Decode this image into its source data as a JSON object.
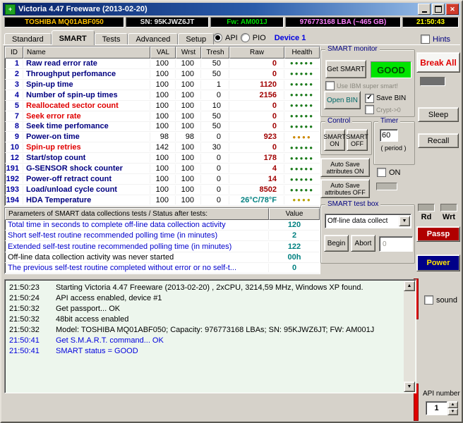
{
  "window": {
    "title": "Victoria 4.47 Freeware (2013-02-20)",
    "close": "✕"
  },
  "infobar": {
    "model": "TOSHIBA MQ01ABF050",
    "serial": "SN: 95KJWZ6JT",
    "firmware": "Fw: AM001J",
    "capacity": "976773168 LBA (~465 GB)",
    "clock": "21:50:43"
  },
  "tabs": [
    "Standard",
    "SMART",
    "Tests",
    "Advanced",
    "Setup"
  ],
  "mode": {
    "api": "API",
    "pio": "PIO",
    "device": "Device 1",
    "hints": "Hints"
  },
  "smart_table": {
    "headers": [
      "ID",
      "Name",
      "VAL",
      "Wrst",
      "Tresh",
      "Raw",
      "Health"
    ],
    "rows": [
      {
        "id": "1",
        "name": "Raw read error rate",
        "val": "100",
        "wrst": "100",
        "tresh": "50",
        "raw": "0",
        "health_dots": 5,
        "health_color": "#1a7a1a"
      },
      {
        "id": "2",
        "name": "Throughput perfomance",
        "val": "100",
        "wrst": "100",
        "tresh": "50",
        "raw": "0",
        "health_dots": 5,
        "health_color": "#1a7a1a"
      },
      {
        "id": "3",
        "name": "Spin-up time",
        "val": "100",
        "wrst": "100",
        "tresh": "1",
        "raw": "1120",
        "health_dots": 5,
        "health_color": "#1a7a1a"
      },
      {
        "id": "4",
        "name": "Number of spin-up times",
        "val": "100",
        "wrst": "100",
        "tresh": "0",
        "raw": "2156",
        "health_dots": 5,
        "health_color": "#1a7a1a"
      },
      {
        "id": "5",
        "name": "Reallocated sector count",
        "val": "100",
        "wrst": "100",
        "tresh": "10",
        "raw": "0",
        "name_color": "#e00000",
        "health_dots": 5,
        "health_color": "#1a7a1a"
      },
      {
        "id": "7",
        "name": "Seek error rate",
        "val": "100",
        "wrst": "100",
        "tresh": "50",
        "raw": "0",
        "name_color": "#e00000",
        "health_dots": 5,
        "health_color": "#1a7a1a"
      },
      {
        "id": "8",
        "name": "Seek time perfomance",
        "val": "100",
        "wrst": "100",
        "tresh": "50",
        "raw": "0",
        "health_dots": 5,
        "health_color": "#1a7a1a"
      },
      {
        "id": "9",
        "name": "Power-on time",
        "val": "98",
        "wrst": "98",
        "tresh": "0",
        "raw": "923",
        "health_dots": 4,
        "health_color": "#cc8800"
      },
      {
        "id": "10",
        "name": "Spin-up retries",
        "val": "142",
        "wrst": "100",
        "tresh": "30",
        "raw": "0",
        "name_color": "#e00000",
        "health_dots": 5,
        "health_color": "#1a7a1a"
      },
      {
        "id": "12",
        "name": "Start/stop count",
        "val": "100",
        "wrst": "100",
        "tresh": "0",
        "raw": "178",
        "health_dots": 5,
        "health_color": "#1a7a1a"
      },
      {
        "id": "191",
        "name": "G-SENSOR shock counter",
        "val": "100",
        "wrst": "100",
        "tresh": "0",
        "raw": "4",
        "health_dots": 5,
        "health_color": "#1a7a1a"
      },
      {
        "id": "192",
        "name": "Power-off retract count",
        "val": "100",
        "wrst": "100",
        "tresh": "0",
        "raw": "14",
        "health_dots": 5,
        "health_color": "#1a7a1a"
      },
      {
        "id": "193",
        "name": "Load/unload cycle count",
        "val": "100",
        "wrst": "100",
        "tresh": "0",
        "raw": "8502",
        "health_dots": 5,
        "health_color": "#1a7a1a"
      },
      {
        "id": "194",
        "name": "HDA Temperature",
        "val": "100",
        "wrst": "100",
        "tresh": "0",
        "raw": "26°C/78°F",
        "raw_color": "#008080",
        "health_dots": 4,
        "health_color": "#b8a000"
      }
    ]
  },
  "params_table": {
    "headers": [
      "Parameters of SMART data collections tests / Status after tests:",
      "Value"
    ],
    "rows": [
      {
        "text": "Total time in seconds to complete off-line data collection activity",
        "value": "120",
        "text_color": "#0000cc"
      },
      {
        "text": "Short self-test routine recommended polling time (in minutes)",
        "value": "2",
        "text_color": "#0000cc"
      },
      {
        "text": "Extended self-test routine recommended polling time (in minutes)",
        "value": "122",
        "text_color": "#0000cc"
      },
      {
        "text": "Off-line data collection activity was never started",
        "value": "00h",
        "text_color": "#000000"
      },
      {
        "text": "The previous self-test routine completed without error or no self-t...",
        "value": "0",
        "text_color": "#0000cc"
      }
    ]
  },
  "monitor": {
    "title": "SMART monitor",
    "get_smart": "Get SMART",
    "status": "GOOD",
    "ibm_check": "Use IBM super smart!",
    "open_bin": "Open BIN",
    "save_bin": "Save BIN",
    "crypt": "Crypt->0"
  },
  "control": {
    "title": "Control",
    "smart_on": "SMART ON",
    "smart_off": "SMART OFF"
  },
  "timer": {
    "title": "Timer",
    "value": "60",
    "period": "( period )",
    "on": "ON"
  },
  "autosave": {
    "on": "Auto Save attributes ON",
    "off": "Auto Save attributes OFF"
  },
  "testbox": {
    "title": "SMART test box",
    "selected": "Off-line data collect",
    "begin": "Begin",
    "abort": "Abort",
    "progress": "0"
  },
  "rightbar": {
    "break_all": "Break All",
    "sleep": "Sleep",
    "recall": "Recall",
    "rd": "Rd",
    "wrt": "Wrt",
    "passp": "Passp",
    "power": "Power",
    "sound": "sound",
    "api_number": "API number",
    "api_value": "1"
  },
  "log": [
    {
      "time": "21:50:23",
      "text": "Starting Victoria 4.47  Freeware  (2013-02-20) , 2xCPU, 3214,59 MHz, Windows XP found.",
      "color": "#000000"
    },
    {
      "time": "21:50:24",
      "text": "API access enabled, device #1",
      "color": "#000000"
    },
    {
      "time": "21:50:32",
      "text": "Get passport... OK",
      "color": "#000000"
    },
    {
      "time": "21:50:32",
      "text": "48bit access enabled",
      "color": "#000000"
    },
    {
      "time": "21:50:32",
      "text": "Model: TOSHIBA MQ01ABF050; Capacity: 976773168 LBAs; SN: 95KJWZ6JT; FW: AM001J",
      "color": "#000000"
    },
    {
      "time": "21:50:41",
      "text": "Get S.M.A.R.T. command... OK",
      "color": "#0000dd"
    },
    {
      "time": "21:50:41",
      "text": "SMART status = GOOD",
      "color": "#0000dd"
    }
  ],
  "colors": {
    "good_bg": "#00e400",
    "accent_red": "#e00000",
    "navy": "#000080"
  }
}
